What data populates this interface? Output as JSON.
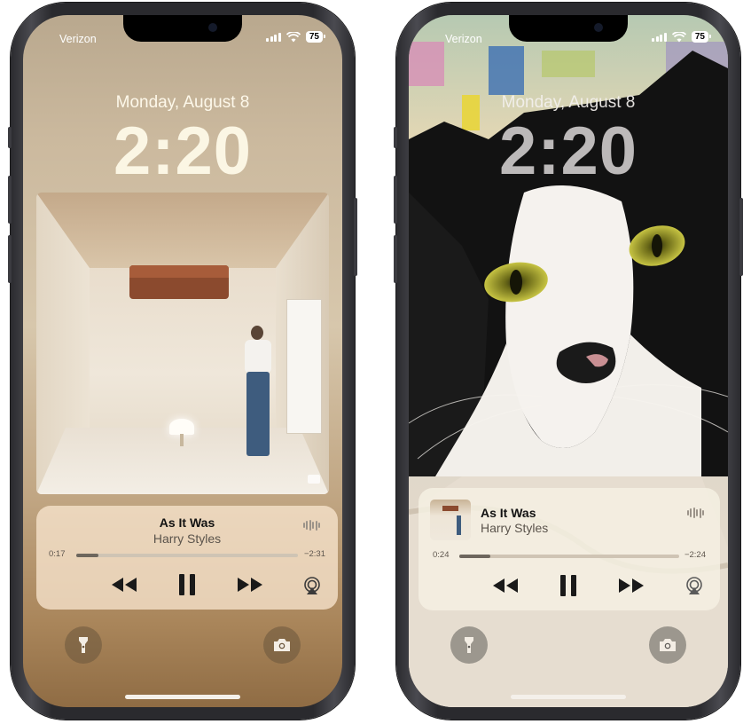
{
  "phones": [
    {
      "carrier": "Verizon",
      "battery": "75",
      "date": "Monday, August 8",
      "time": "2:20",
      "player": {
        "title": "As It Was",
        "artist": "Harry Styles",
        "elapsed": "0:17",
        "remaining": "−2:31",
        "progress": 0.1
      }
    },
    {
      "carrier": "Verizon",
      "battery": "75",
      "date": "Monday, August 8",
      "time": "2:20",
      "player": {
        "title": "As It Was",
        "artist": "Harry Styles",
        "elapsed": "0:24",
        "remaining": "−2:24",
        "progress": 0.14
      }
    }
  ],
  "icons": {
    "rewind": "rewind-icon",
    "pause": "pause-icon",
    "forward": "fast-forward-icon",
    "airplay": "airplay-icon",
    "flashlight": "flashlight-icon",
    "camera": "camera-icon"
  },
  "colors": {
    "left_wallpaper": "#c8b598",
    "player_left": "#f7e4cd",
    "player_right": "#f5f0e2"
  }
}
